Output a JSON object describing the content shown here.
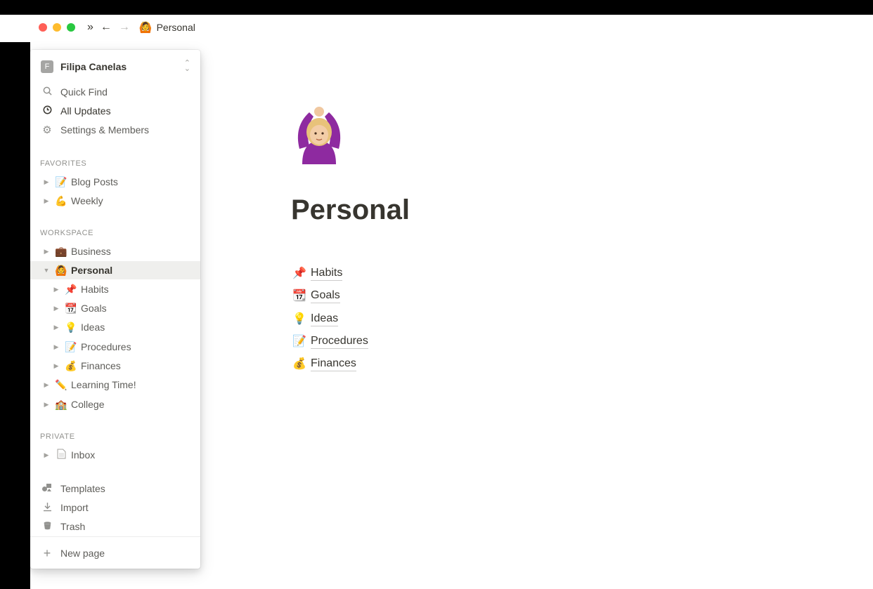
{
  "titlebar": {
    "expand_icon": "double-chevron-right",
    "back_icon": "arrow-left",
    "forward_icon": "arrow-right",
    "breadcrumb_emoji": "🙆",
    "breadcrumb_title": "Personal"
  },
  "sidebar": {
    "workspace": {
      "avatar_letter": "F",
      "name": "Filipa Canelas"
    },
    "top_items": [
      {
        "icon": "search-icon",
        "label": "Quick Find"
      },
      {
        "icon": "clock-icon",
        "label": "All Updates"
      },
      {
        "icon": "gear-icon",
        "label": "Settings & Members"
      }
    ],
    "favorites_label": "FAVORITES",
    "favorites": [
      {
        "emoji": "📝",
        "label": "Blog Posts"
      },
      {
        "emoji": "💪",
        "label": "Weekly"
      }
    ],
    "workspace_label": "WORKSPACE",
    "workspace_items": [
      {
        "emoji": "💼",
        "label": "Business"
      },
      {
        "emoji": "🙆",
        "label": "Personal"
      },
      {
        "emoji": "📌",
        "label": "Habits"
      },
      {
        "emoji": "📆",
        "label": "Goals"
      },
      {
        "emoji": "💡",
        "label": "Ideas"
      },
      {
        "emoji": "📝",
        "label": "Procedures"
      },
      {
        "emoji": "💰",
        "label": "Finances"
      },
      {
        "emoji": "✏️",
        "label": "Learning Time!"
      },
      {
        "emoji": "🏫",
        "label": "College"
      }
    ],
    "private_label": "PRIVATE",
    "private_items": [
      {
        "emoji": "🗒",
        "label": "Inbox"
      }
    ],
    "bottom_items": [
      {
        "icon": "templates-icon",
        "label": "Templates"
      },
      {
        "icon": "import-icon",
        "label": "Import"
      },
      {
        "icon": "trash-icon",
        "label": "Trash"
      }
    ],
    "new_page_label": "New page"
  },
  "page": {
    "icon": "person-gesturing-ok",
    "title": "Personal",
    "links": [
      {
        "emoji": "📌",
        "label": "Habits"
      },
      {
        "emoji": "📆",
        "label": "Goals"
      },
      {
        "emoji": "💡",
        "label": "Ideas"
      },
      {
        "emoji": "📝",
        "label": "Procedures"
      },
      {
        "emoji": "💰",
        "label": "Finances"
      }
    ]
  }
}
